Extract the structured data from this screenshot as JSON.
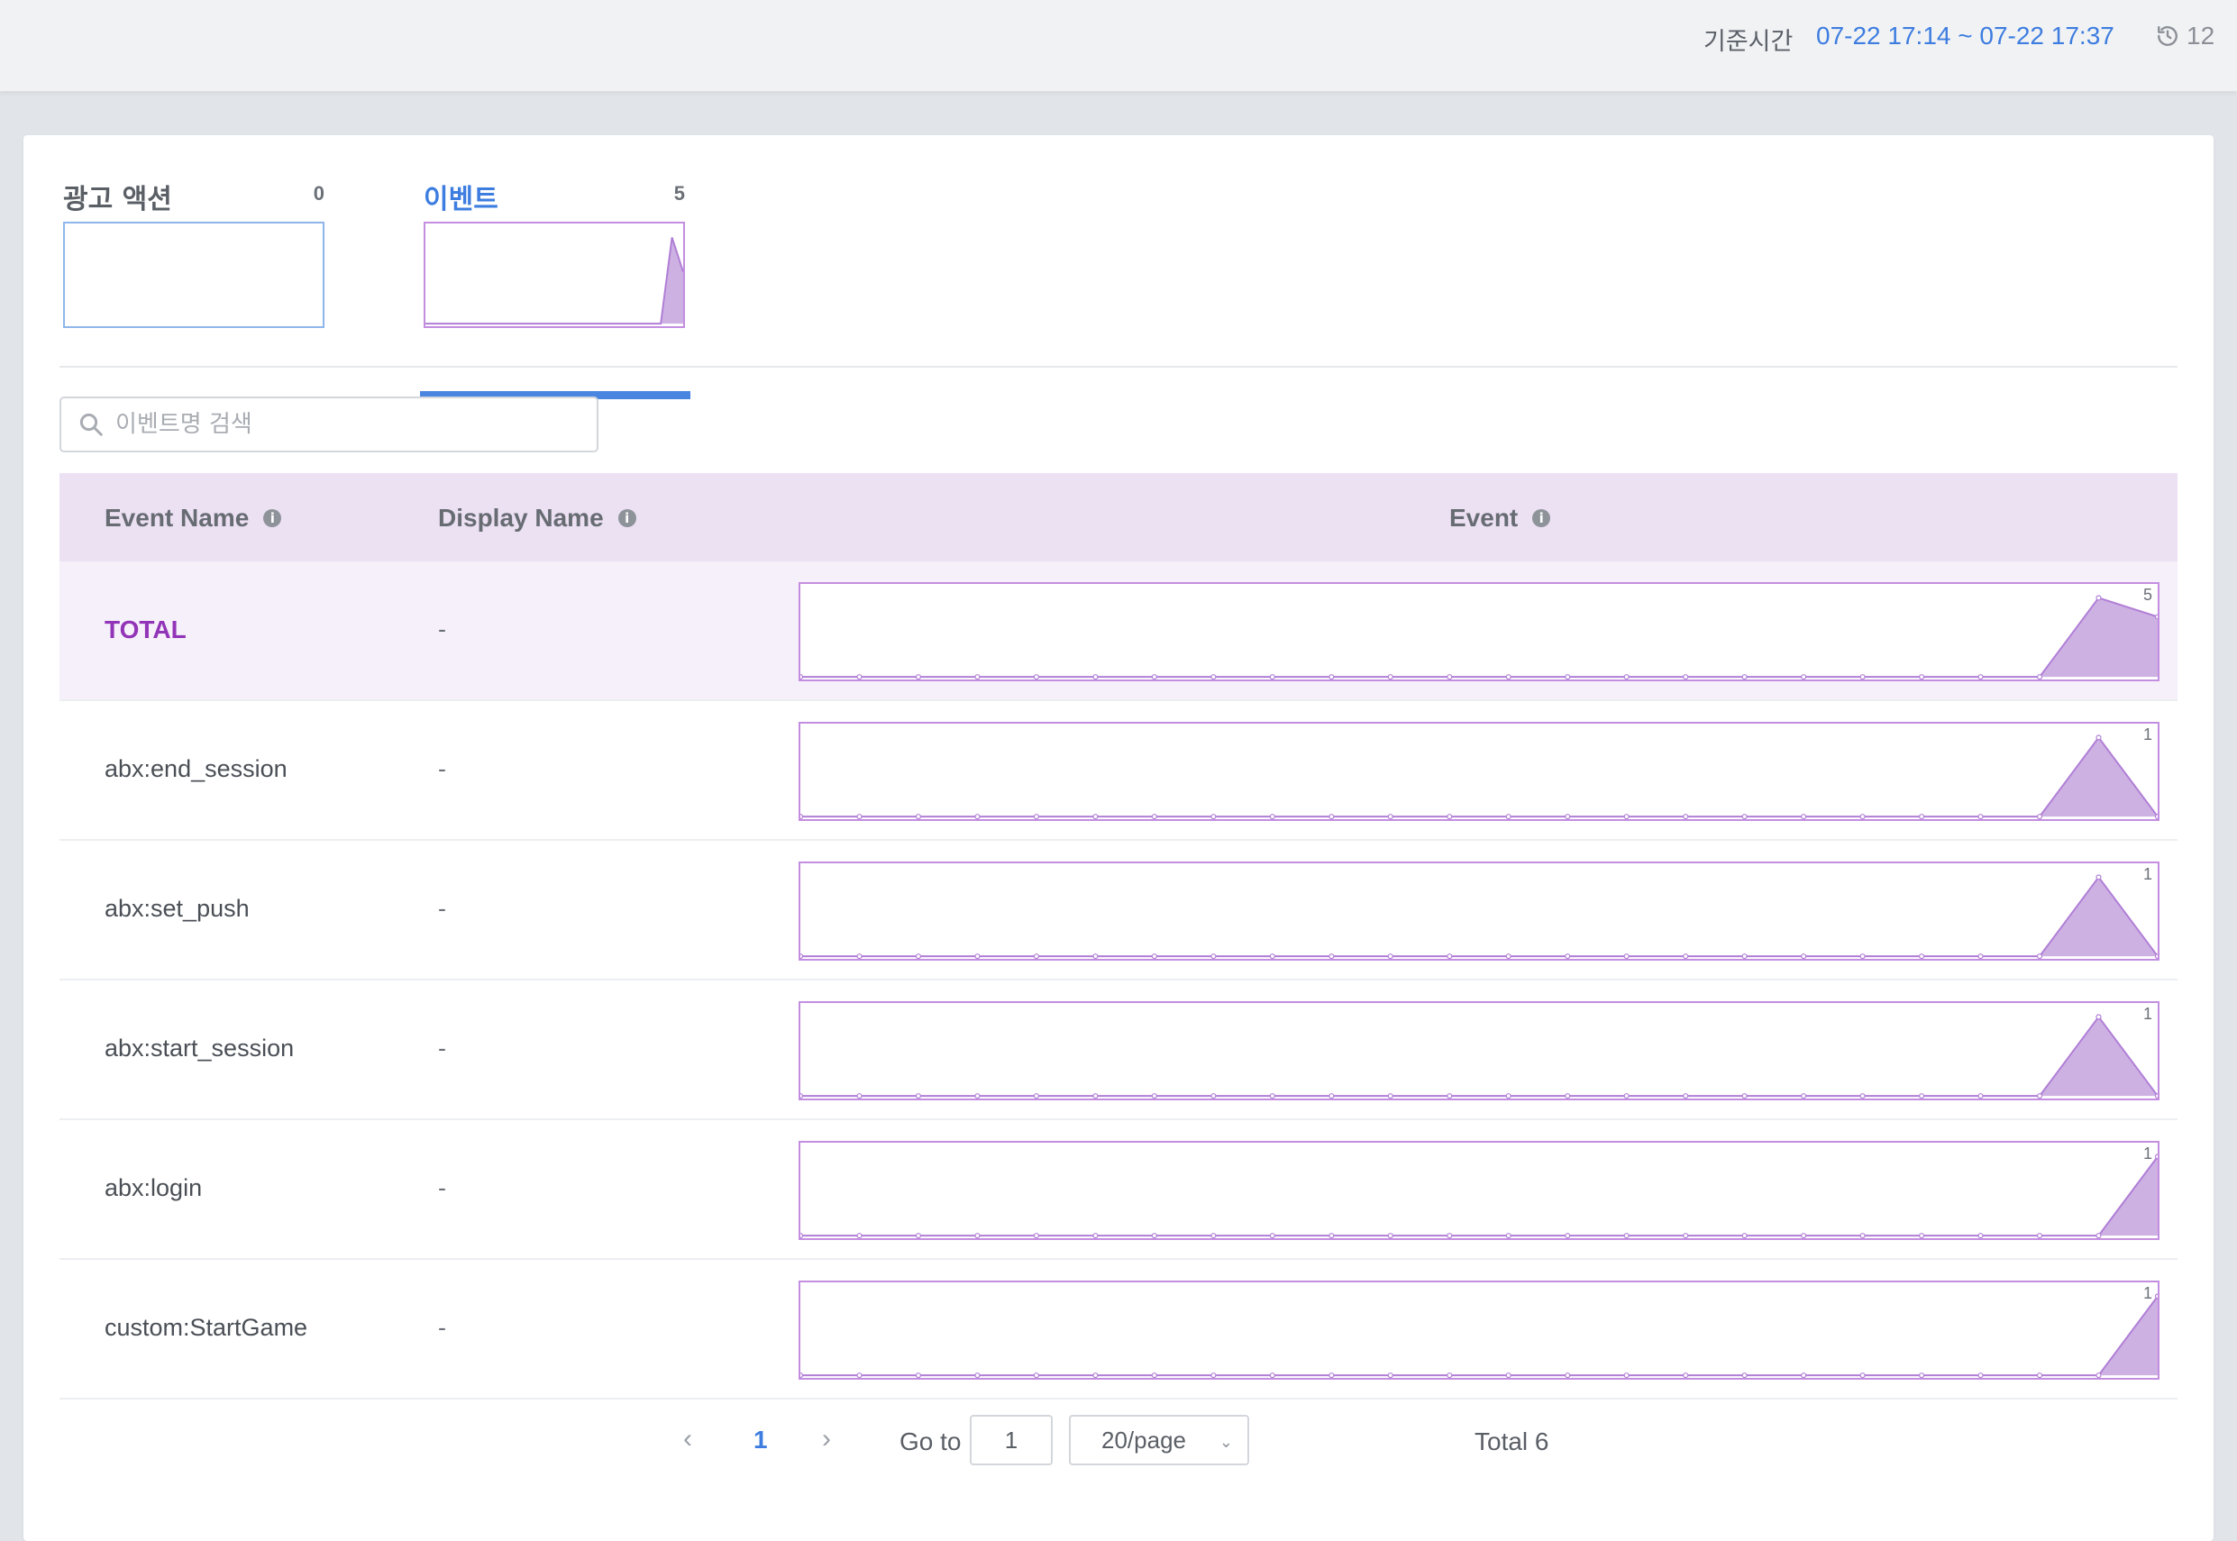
{
  "topbar": {
    "label": "기준시간",
    "range": "07-22 17:14 ~ 07-22 17:37",
    "refresh_count": "12"
  },
  "tabs": [
    {
      "id": "ad",
      "name": "광고 액션",
      "count": "0",
      "values": [
        0,
        0,
        0,
        0,
        0,
        0,
        0,
        0,
        0,
        0,
        0,
        0,
        0,
        0,
        0,
        0,
        0,
        0,
        0,
        0,
        0,
        0,
        0,
        0
      ]
    },
    {
      "id": "event",
      "name": "이벤트",
      "count": "5",
      "values": [
        0,
        0,
        0,
        0,
        0,
        0,
        0,
        0,
        0,
        0,
        0,
        0,
        0,
        0,
        0,
        0,
        0,
        0,
        0,
        0,
        0,
        0,
        5,
        3
      ]
    }
  ],
  "active_tab": "event",
  "search": {
    "placeholder": "이벤트명 검색"
  },
  "table": {
    "headers": {
      "event_name": "Event Name",
      "display_name": "Display Name",
      "event": "Event"
    },
    "rows": [
      {
        "event_name": "TOTAL",
        "display_name": "-",
        "max": "5",
        "values": [
          0,
          0,
          0,
          0,
          0,
          0,
          0,
          0,
          0,
          0,
          0,
          0,
          0,
          0,
          0,
          0,
          0,
          0,
          0,
          0,
          0,
          0,
          5,
          3.8
        ]
      },
      {
        "event_name": "abx:end_session",
        "display_name": "-",
        "max": "1",
        "values": [
          0,
          0,
          0,
          0,
          0,
          0,
          0,
          0,
          0,
          0,
          0,
          0,
          0,
          0,
          0,
          0,
          0,
          0,
          0,
          0,
          0,
          0,
          1,
          0
        ]
      },
      {
        "event_name": "abx:set_push",
        "display_name": "-",
        "max": "1",
        "values": [
          0,
          0,
          0,
          0,
          0,
          0,
          0,
          0,
          0,
          0,
          0,
          0,
          0,
          0,
          0,
          0,
          0,
          0,
          0,
          0,
          0,
          0,
          1,
          0
        ]
      },
      {
        "event_name": "abx:start_session",
        "display_name": "-",
        "max": "1",
        "values": [
          0,
          0,
          0,
          0,
          0,
          0,
          0,
          0,
          0,
          0,
          0,
          0,
          0,
          0,
          0,
          0,
          0,
          0,
          0,
          0,
          0,
          0,
          1,
          0
        ]
      },
      {
        "event_name": "abx:login",
        "display_name": "-",
        "max": "1",
        "values": [
          0,
          0,
          0,
          0,
          0,
          0,
          0,
          0,
          0,
          0,
          0,
          0,
          0,
          0,
          0,
          0,
          0,
          0,
          0,
          0,
          0,
          0,
          0,
          0.9
        ]
      },
      {
        "event_name": "custom:StartGame",
        "display_name": "-",
        "max": "1",
        "values": [
          0,
          0,
          0,
          0,
          0,
          0,
          0,
          0,
          0,
          0,
          0,
          0,
          0,
          0,
          0,
          0,
          0,
          0,
          0,
          0,
          0,
          0,
          0,
          0.9
        ]
      }
    ]
  },
  "pagination": {
    "prev": "‹",
    "page": "1",
    "next": "›",
    "goto_label": "Go to",
    "goto_value": "1",
    "page_size": "20/page",
    "total": "Total 6"
  },
  "colors": {
    "accent": "#3d7de0",
    "chart_line": "#b07ed6",
    "chart_fill": "#cdb1e3",
    "total_text": "#9234b8",
    "header_bg": "#ece0f3"
  },
  "icons": {
    "refresh": "history-icon",
    "search": "search-icon",
    "info": "info-icon",
    "caret": "chevron-down-icon"
  }
}
